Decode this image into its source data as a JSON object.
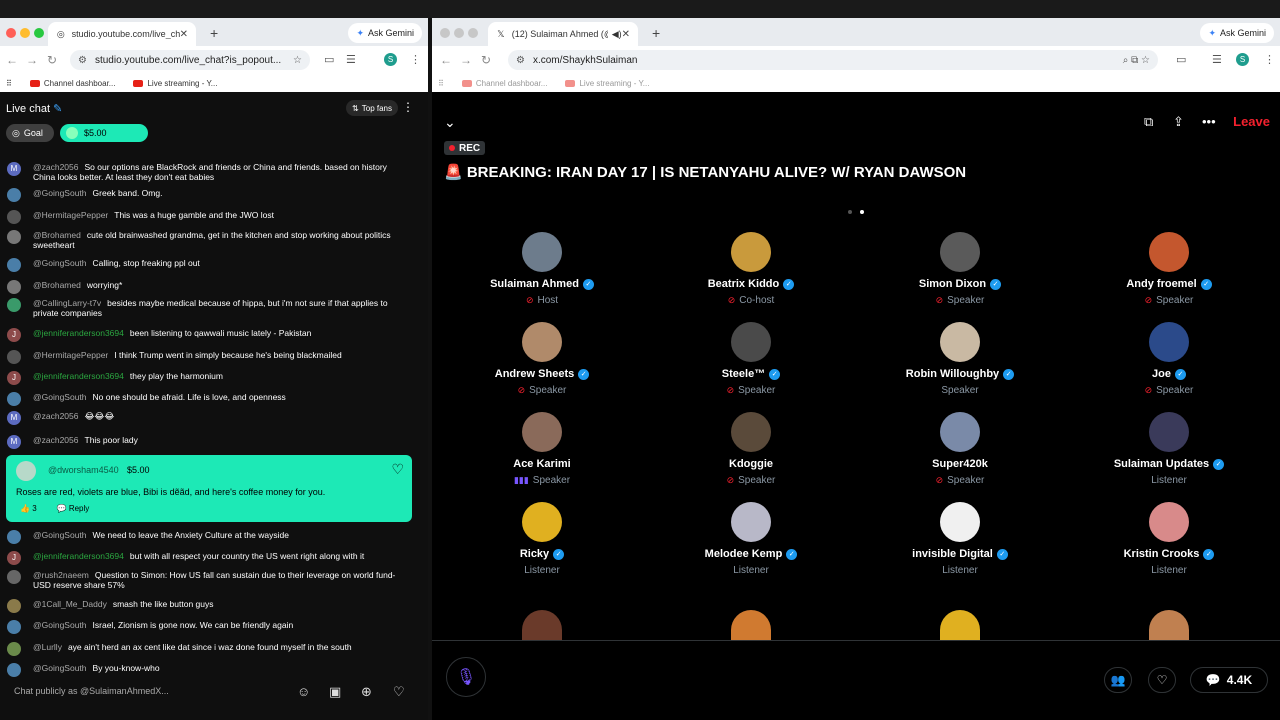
{
  "left_window": {
    "tab_title": "studio.youtube.com/live_chat",
    "url": "studio.youtube.com/live_chat?is_popout...",
    "ask_gemini": "Ask Gemini",
    "bookmarks": [
      "Channel dashboar...",
      "Live streaming - Y..."
    ],
    "chat": {
      "title": "Live chat",
      "top_fans": "Top fans",
      "goal_label": "Goal",
      "goal_amount": "$5.00",
      "messages": [
        {
          "author": "@zach2056",
          "text": "So our options are BlackRock and friends or China and friends. based on history",
          "text2": "China looks better. At least they don't eat babies",
          "avatar": "M",
          "color": "#5c6bc0",
          "green": false
        },
        {
          "author": "@GoingSouth",
          "text": "Greek band. Omg.",
          "avatar": "",
          "color": "#4a7ea8",
          "green": false
        },
        {
          "author": "@HermitagePepper",
          "text": "This was a huge gamble and the JWO lost",
          "avatar": "",
          "color": "#555",
          "green": false
        },
        {
          "author": "@Brohamed",
          "text": "cute old brainwashed grandma, get in the kitchen and stop working about politics",
          "text2": "sweetheart",
          "avatar": "",
          "color": "#777",
          "green": false
        },
        {
          "author": "@GoingSouth",
          "text": "Calling, stop freaking ppl out",
          "avatar": "",
          "color": "#4a7ea8",
          "green": false
        },
        {
          "author": "@Brohamed",
          "text": "worrying*",
          "avatar": "",
          "color": "#777",
          "green": false
        },
        {
          "author": "@CallingLarry-t7v",
          "text": "besides maybe medical because of hippa, but i'm not sure if that applies to",
          "text2": "private companies",
          "avatar": "",
          "color": "#3a9a6a",
          "green": false
        },
        {
          "author": "@jenniferanderson3694",
          "text": "been listening to qawwali music lately - Pakistan",
          "avatar": "J",
          "color": "#8d4b4b",
          "green": true
        },
        {
          "author": "@HermitagePepper",
          "text": "I think Trump went in simply because he's being blackmailed",
          "avatar": "",
          "color": "#555",
          "green": false
        },
        {
          "author": "@jenniferanderson3694",
          "text": "they play the harmonium",
          "avatar": "J",
          "color": "#8d4b4b",
          "green": true
        },
        {
          "author": "@GoingSouth",
          "text": "No one should be afraid. Life is love, and openness",
          "avatar": "",
          "color": "#4a7ea8",
          "green": false
        },
        {
          "author": "@zach2056",
          "text": "😂😂😂",
          "avatar": "M",
          "color": "#5c6bc0",
          "green": false
        },
        {
          "author": "@zach2056",
          "text": "This poor lady",
          "avatar": "M",
          "color": "#5c6bc0",
          "green": false
        }
      ],
      "superchat": {
        "author": "@dworsham4540",
        "amount": "$5.00",
        "text": "Roses are red, violets are blue, Bibi is dẽãd, and here's coffee money for you.",
        "likes": "3",
        "reply": "Reply"
      },
      "messages_after": [
        {
          "author": "@GoingSouth",
          "text": "We need to leave the Anxiety Culture at the wayside",
          "avatar": "",
          "color": "#4a7ea8",
          "green": false
        },
        {
          "author": "@jenniferanderson3694",
          "text": "but with all respect your country the US went right along with it",
          "avatar": "J",
          "color": "#8d4b4b",
          "green": true
        },
        {
          "author": "@rush2naeem",
          "text": "Question to Simon: How US fall can sustain due to their leverage on world fund-",
          "text2": "USD reserve share 57%",
          "avatar": "",
          "color": "#666",
          "green": false
        },
        {
          "author": "@1Call_Me_Daddy",
          "text": "smash the like button guys",
          "avatar": "",
          "color": "#8a7a4a",
          "green": false
        },
        {
          "author": "@GoingSouth",
          "text": "Israel, Zionism is gone now. We can be friendly again",
          "avatar": "",
          "color": "#4a7ea8",
          "green": false
        },
        {
          "author": "@Lurlly",
          "text": "aye ain't herd an ax cent like dat since i waz done found myself in the south",
          "avatar": "",
          "color": "#6a8a4a",
          "green": false
        },
        {
          "author": "@GoingSouth",
          "text": "By you-know-who",
          "avatar": "",
          "color": "#4a7ea8",
          "green": false
        }
      ],
      "input_placeholder": "Chat publicly as @SulaimanAhmedX..."
    }
  },
  "right_window": {
    "tab_title": "(12) Sulaiman Ahmed (@S",
    "url": "x.com/ShaykhSulaiman",
    "ask_gemini": "Ask Gemini",
    "bookmarks": [
      "Channel dashboar...",
      "Live streaming - Y..."
    ],
    "space": {
      "leave": "Leave",
      "rec": "REC",
      "title": "🚨 BREAKING: IRAN DAY 17 | IS NETANYAHU ALIVE? W/ RYAN DAWSON",
      "participants": [
        {
          "name": "Sulaiman Ahmed",
          "role": "Host",
          "verified": true,
          "state": "muted",
          "color": "#6d7c8c"
        },
        {
          "name": "Beatrix Kiddo",
          "role": "Co-host",
          "verified": true,
          "state": "muted",
          "color": "#c99a3c"
        },
        {
          "name": "Simon Dixon",
          "role": "Speaker",
          "verified": true,
          "state": "muted",
          "color": "#5a5a5a"
        },
        {
          "name": "Andy froemel",
          "role": "Speaker",
          "verified": true,
          "state": "muted",
          "color": "#c4572e"
        },
        {
          "name": "Andrew Sheets",
          "role": "Speaker",
          "verified": true,
          "state": "muted",
          "color": "#b08a6a"
        },
        {
          "name": "Steele™",
          "role": "Speaker",
          "verified": true,
          "state": "muted",
          "color": "#4a4a4a"
        },
        {
          "name": "Robin Willoughby",
          "role": "Speaker",
          "verified": true,
          "state": "none",
          "color": "#c9b9a3"
        },
        {
          "name": "Joe",
          "role": "Speaker",
          "verified": true,
          "state": "muted",
          "color": "#2b4a8a"
        },
        {
          "name": "Ace Karimi",
          "role": "Speaker",
          "verified": false,
          "state": "speaking",
          "color": "#8a6a5a"
        },
        {
          "name": "Kdoggie",
          "role": "Speaker",
          "verified": false,
          "state": "muted",
          "color": "#5a4a3a"
        },
        {
          "name": "Super420k",
          "role": "Speaker",
          "verified": false,
          "state": "muted",
          "color": "#7a8aa8"
        },
        {
          "name": "Sulaiman Updates",
          "role": "Listener",
          "verified": true,
          "state": "none",
          "color": "#3a3a5a"
        },
        {
          "name": "Ricky",
          "role": "Listener",
          "verified": true,
          "state": "none",
          "color": "#e0b020"
        },
        {
          "name": "Melodee Kemp",
          "role": "Listener",
          "verified": true,
          "state": "none",
          "color": "#b8b8c8"
        },
        {
          "name": "invisible Digital",
          "role": "Listener",
          "verified": true,
          "state": "none",
          "color": "#f0f0f0"
        },
        {
          "name": "Kristin Crooks",
          "role": "Listener",
          "verified": true,
          "state": "none",
          "color": "#d88a8a"
        }
      ],
      "next_row_colors": [
        "#6a3a2a",
        "#d07a30",
        "#e0b020",
        "#c08050"
      ],
      "reply_count": "4.4K"
    }
  }
}
